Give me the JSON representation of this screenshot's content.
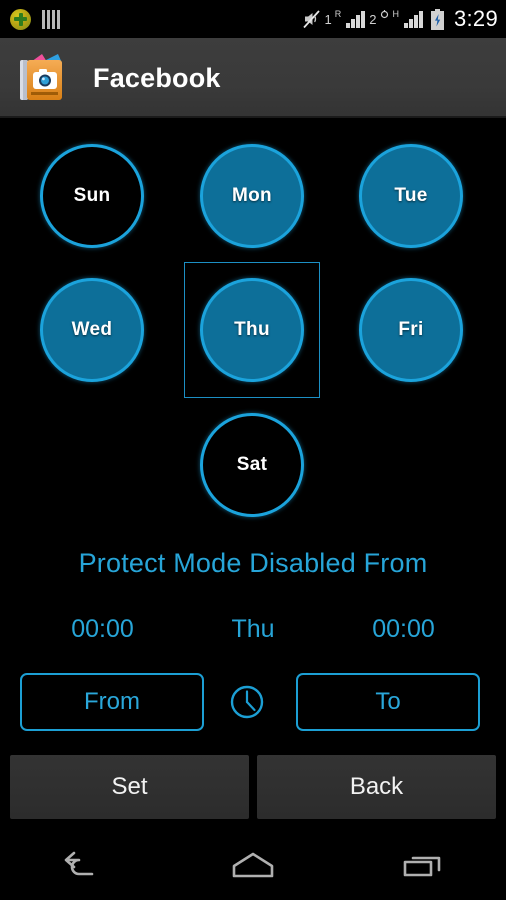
{
  "status_bar": {
    "icons_left": [
      "market-plus-icon",
      "bars-icon"
    ],
    "mute_icon": "mute-icon",
    "sim1_label": "1",
    "sim1_network": "R",
    "sim2_label": "2",
    "sim2_network": "H",
    "battery_icon": "battery-charging-icon",
    "clock": "3:29"
  },
  "app_bar": {
    "icon": "photo-album-camera-icon",
    "title": "Facebook"
  },
  "days": [
    {
      "label": "Sun",
      "enabled": false,
      "selected": false
    },
    {
      "label": "Mon",
      "enabled": true,
      "selected": false
    },
    {
      "label": "Tue",
      "enabled": true,
      "selected": false
    },
    {
      "label": "Wed",
      "enabled": true,
      "selected": false
    },
    {
      "label": "Thu",
      "enabled": true,
      "selected": true
    },
    {
      "label": "Fri",
      "enabled": true,
      "selected": false
    },
    {
      "label": "Sat",
      "enabled": false,
      "selected": false
    }
  ],
  "schedule": {
    "headline": "Protect Mode Disabled From",
    "from_time": "00:00",
    "day": "Thu",
    "to_time": "00:00",
    "from_button": "From",
    "to_button": "To",
    "clock_icon": "clock-icon"
  },
  "actions": {
    "set_label": "Set",
    "back_label": "Back"
  },
  "nav_bar": {
    "back_icon": "back-arrow-icon",
    "home_icon": "home-icon",
    "recents_icon": "recents-icon"
  },
  "colors": {
    "accent_cyan": "#1ba3dc",
    "accent_text": "#27a5d8",
    "circle_fill": "#0d6f99",
    "app_bar_bg": "#3a3a3a",
    "button_bg": "#2f2f2f",
    "background": "#000000"
  }
}
